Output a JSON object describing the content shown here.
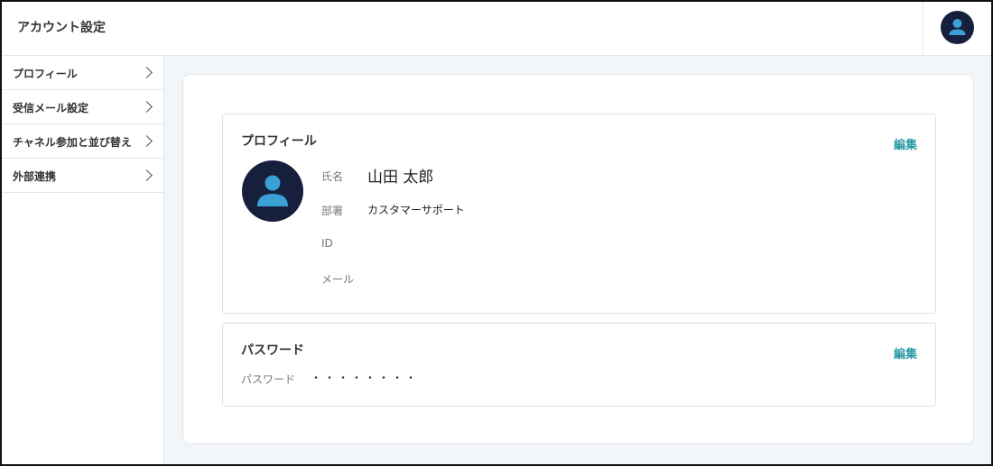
{
  "header": {
    "title": "アカウント設定",
    "avatar_icon": "user-avatar-icon"
  },
  "sidebar": {
    "items": [
      {
        "label": "プロフィール",
        "icon": "chevron-right-icon"
      },
      {
        "label": "受信メール設定",
        "icon": "chevron-right-icon"
      },
      {
        "label": "チャネル参加と並び替え",
        "icon": "chevron-right-icon"
      },
      {
        "label": "外部連携",
        "icon": "chevron-right-icon"
      }
    ]
  },
  "profile": {
    "title": "プロフィール",
    "edit_label": "編集",
    "fields": {
      "name_label": "氏名",
      "name_value": "山田 太郎",
      "department_label": "部署",
      "department_value": "カスタマーサポート",
      "id_label": "ID",
      "id_value": "",
      "email_label": "メール",
      "email_value": ""
    }
  },
  "password": {
    "title": "パスワード",
    "edit_label": "編集",
    "label": "パスワード",
    "value": "・・・・・・・・"
  },
  "colors": {
    "accent": "#2a9aa5",
    "avatar_bg": "#16203d",
    "avatar_person": "#3aa0d6"
  }
}
